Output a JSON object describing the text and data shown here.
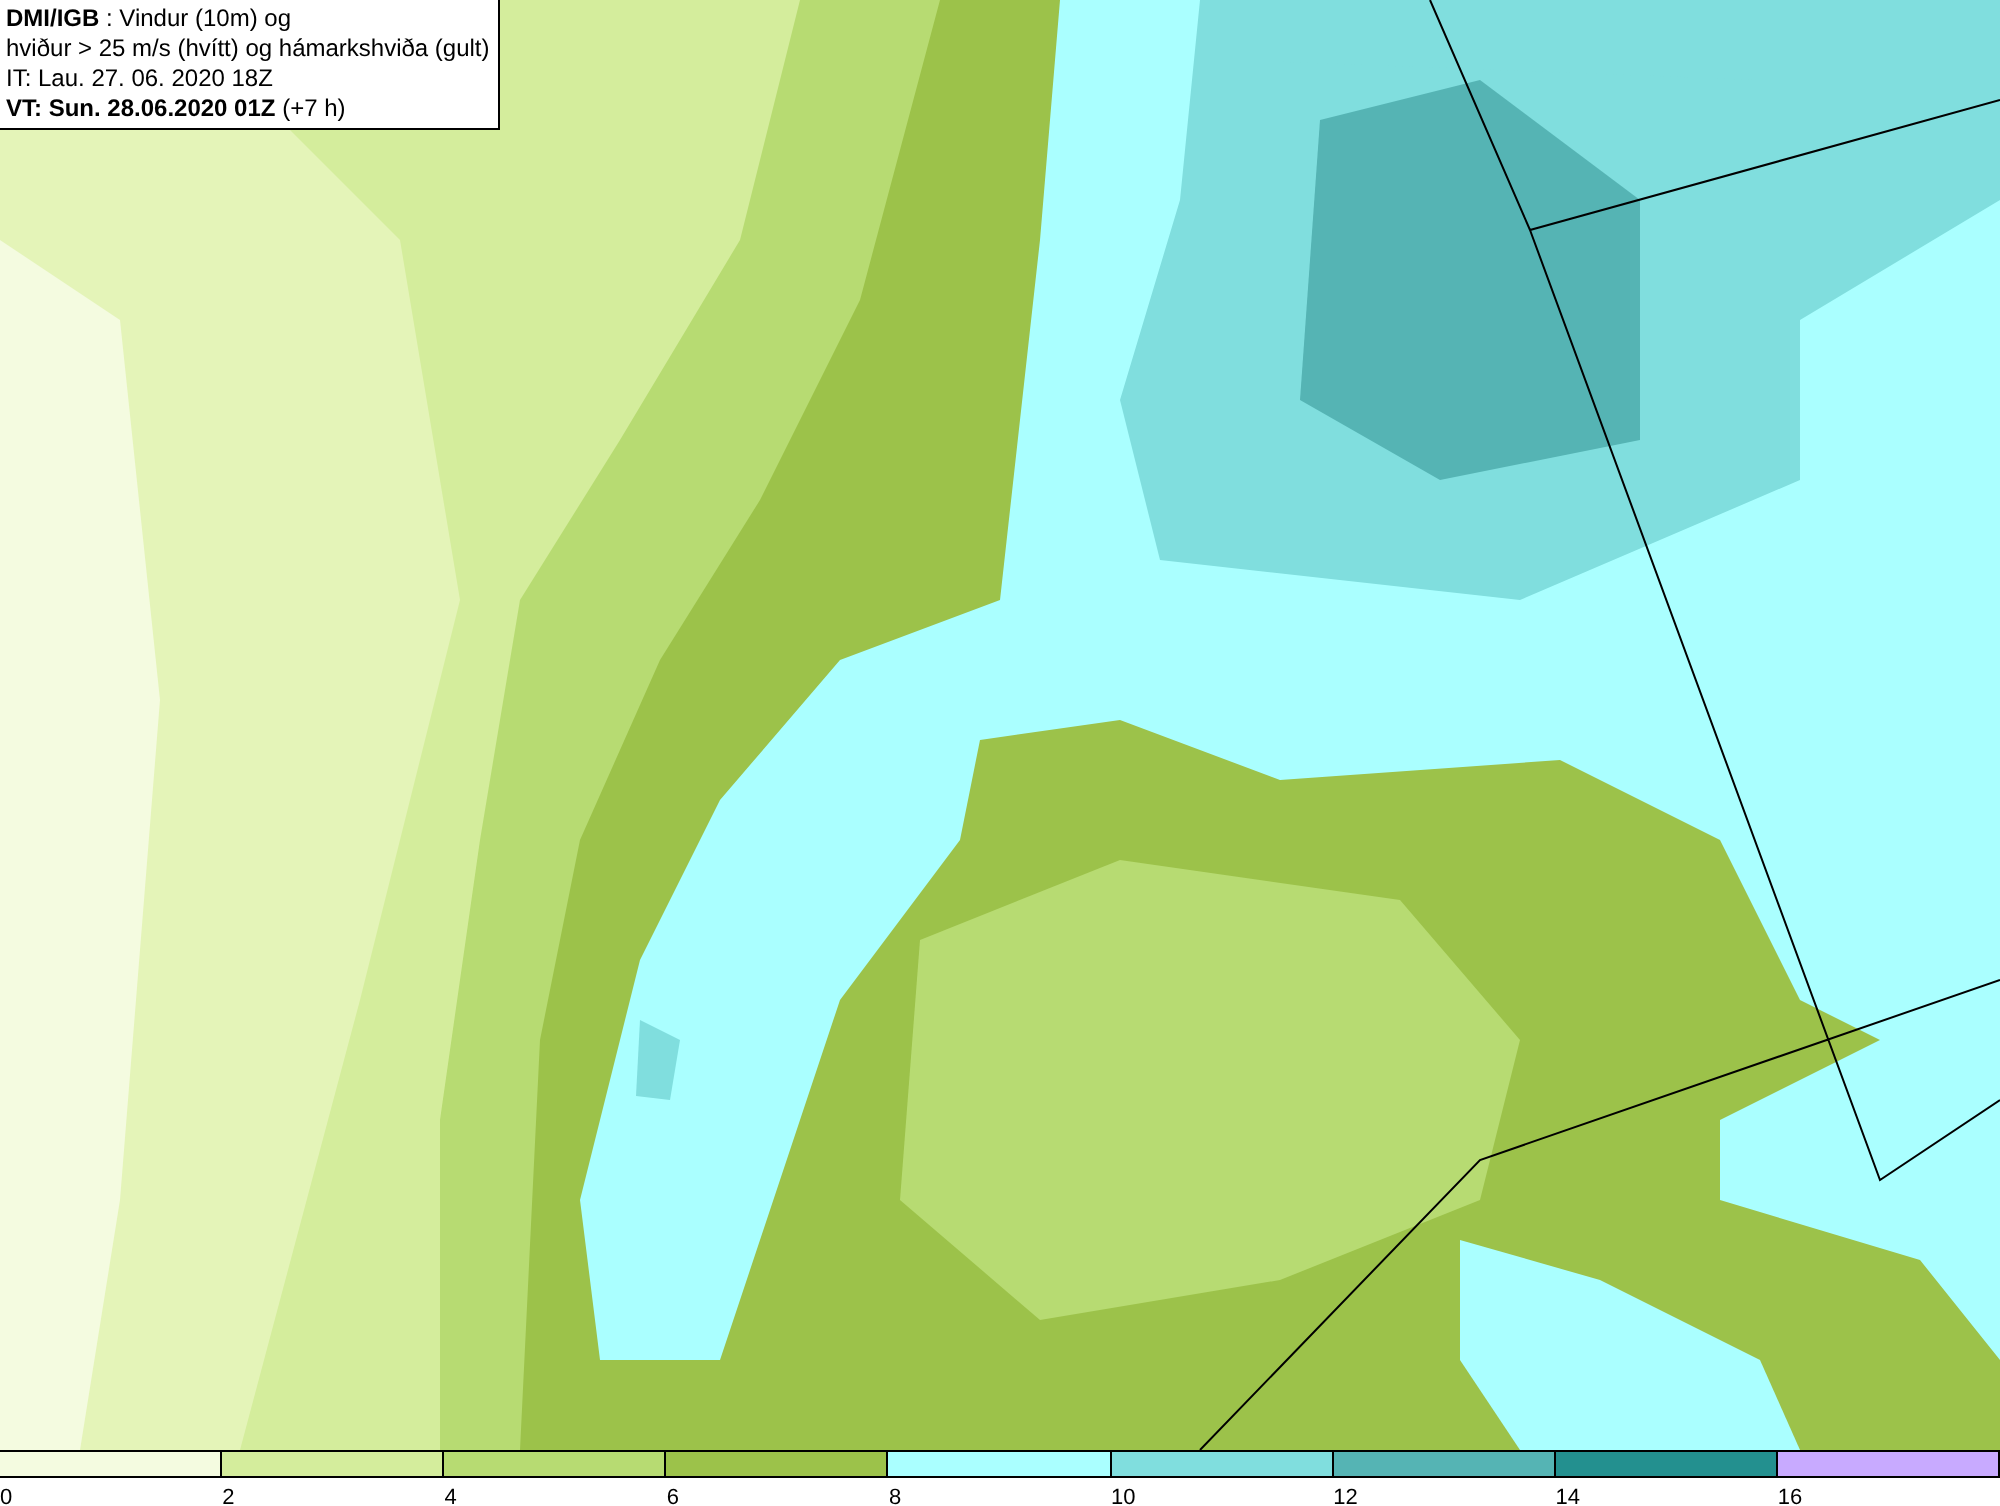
{
  "title_box": {
    "lines": [
      "**DMI/IGB** : Vindur (10m) og",
      "hviður > 25 m/s (hvítt) og hámarkshviða (gult)",
      "IT: Lau. 27. 06. 2020 18Z",
      "**VT: Sun. 28.06.2020 01Z** (+7 h)"
    ]
  },
  "legend": {
    "bins": [
      {
        "color": "#f4fbe0",
        "label": "0"
      },
      {
        "color": "#d4ed9c",
        "label": "2"
      },
      {
        "color": "#b7db72",
        "label": "4"
      },
      {
        "color": "#9cc24a",
        "label": "6"
      },
      {
        "color": "#aaffff",
        "label": "8"
      },
      {
        "color": "#80dede",
        "label": "10"
      },
      {
        "color": "#55b4b4",
        "label": "12"
      },
      {
        "color": "#23908f",
        "label": "14"
      },
      {
        "color": "#c8aaff",
        "label": "16"
      }
    ]
  }
}
